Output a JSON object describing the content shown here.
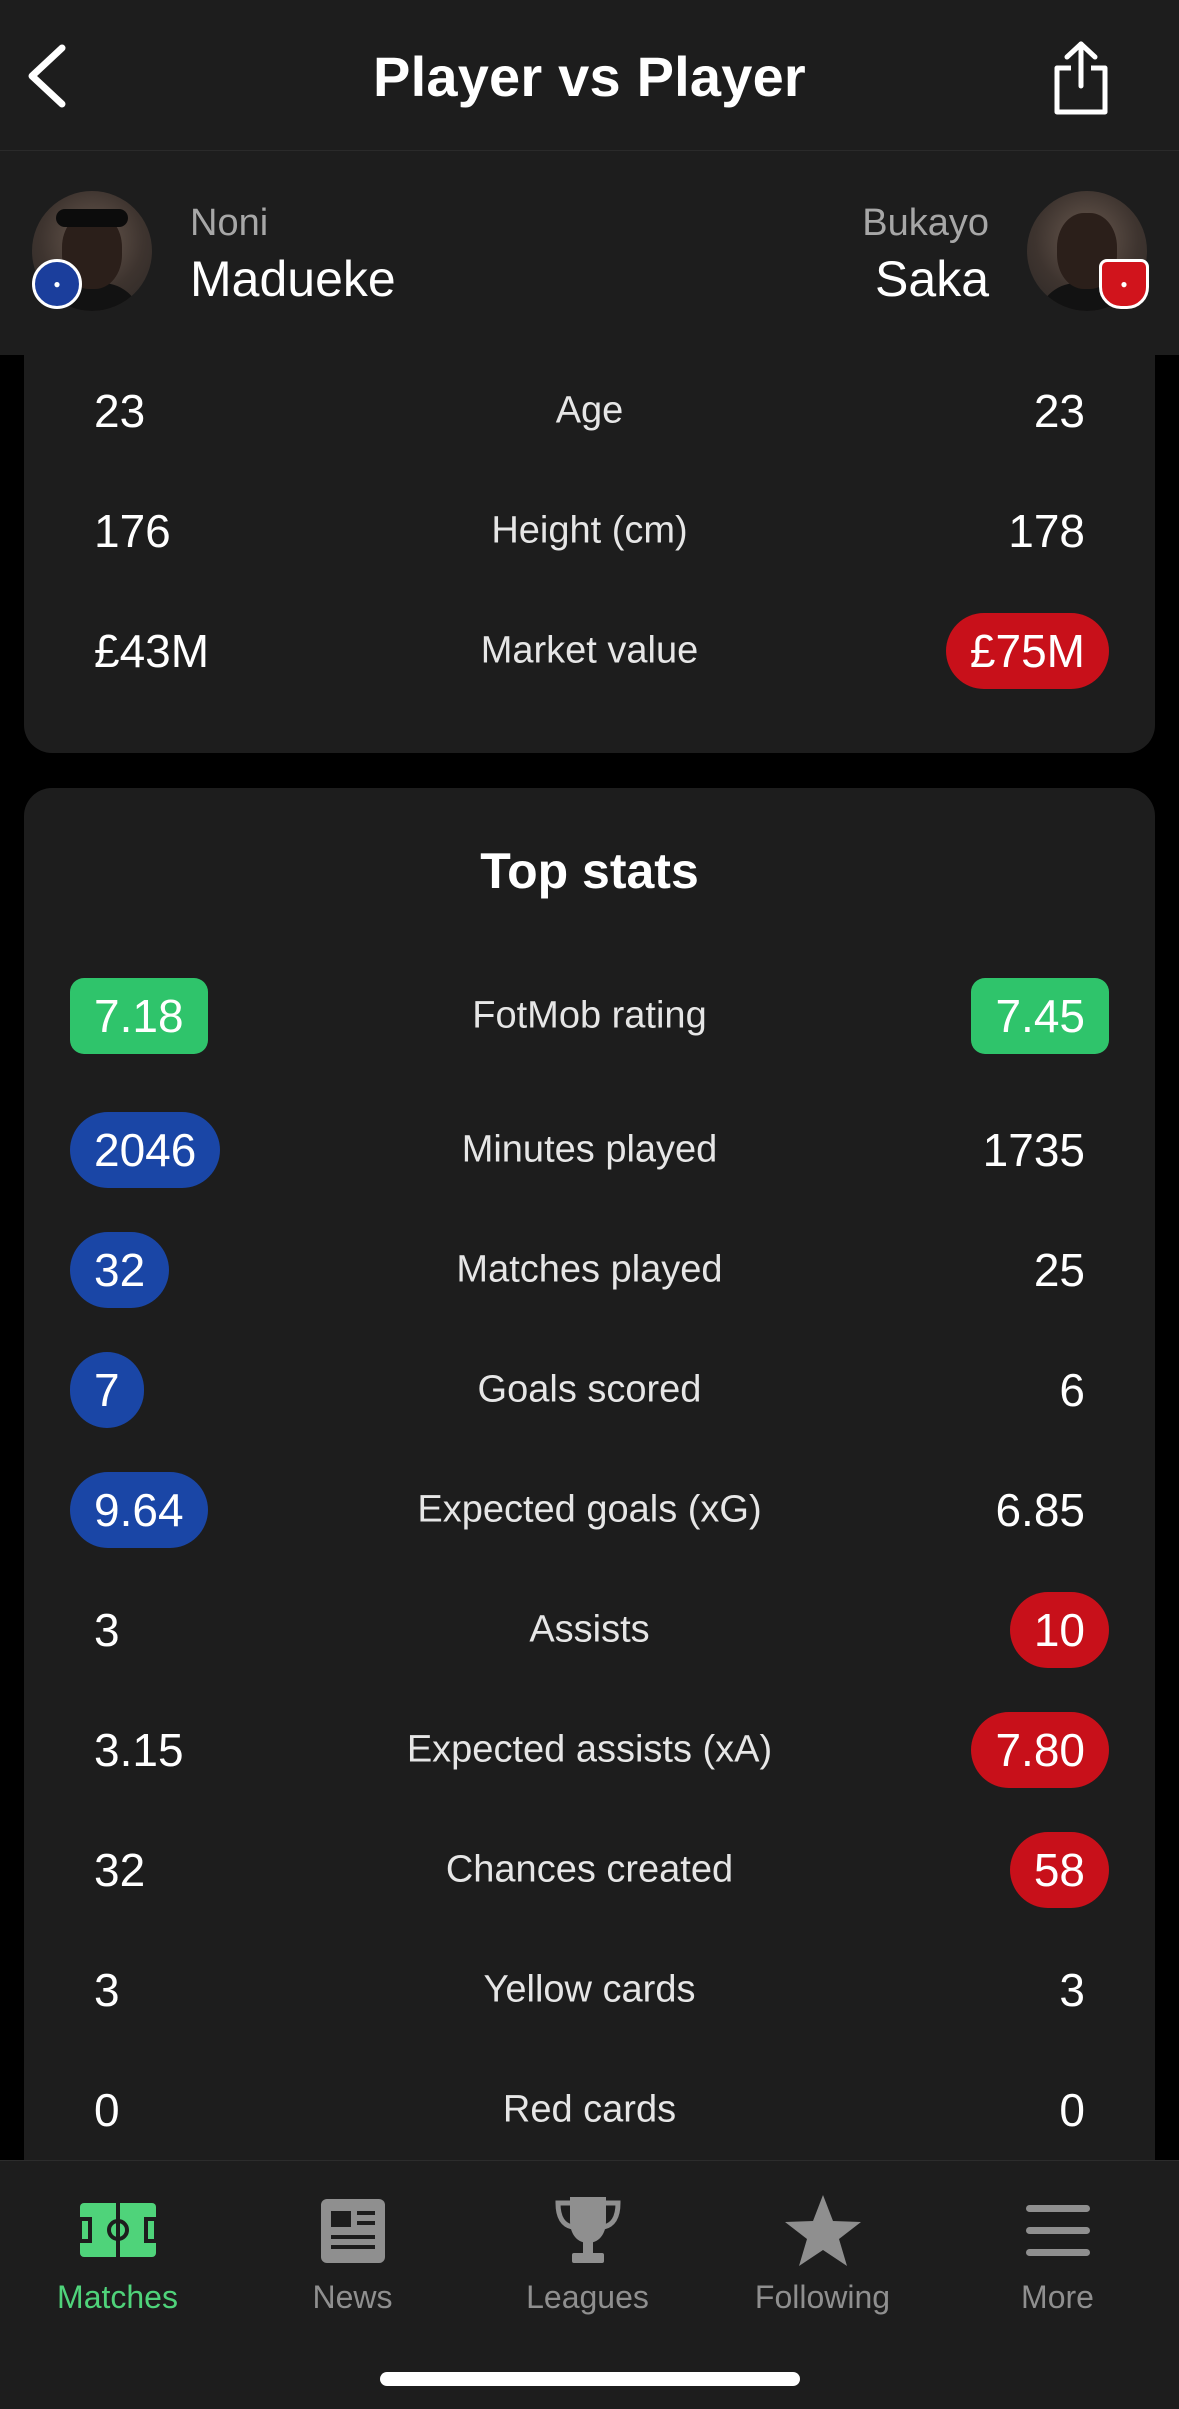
{
  "header": {
    "title": "Player vs Player"
  },
  "players": {
    "left": {
      "first_name": "Noni",
      "last_name": "Madueke",
      "club": "Chelsea"
    },
    "right": {
      "first_name": "Bukayo",
      "last_name": "Saka",
      "club": "Arsenal"
    }
  },
  "bio": [
    {
      "label": "Age",
      "left": "23",
      "right": "23",
      "highlight": "none"
    },
    {
      "label": "Height (cm)",
      "left": "176",
      "right": "178",
      "highlight": "none"
    },
    {
      "label": "Market value",
      "left": "£43M",
      "right": "£75M",
      "highlight": "right-red"
    }
  ],
  "top_stats": {
    "title": "Top stats",
    "rows": [
      {
        "label": "FotMob rating",
        "left": "7.18",
        "right": "7.45",
        "highlight": "both-green"
      },
      {
        "label": "Minutes played",
        "left": "2046",
        "right": "1735",
        "highlight": "left-blue"
      },
      {
        "label": "Matches played",
        "left": "32",
        "right": "25",
        "highlight": "left-blue"
      },
      {
        "label": "Goals scored",
        "left": "7",
        "right": "6",
        "highlight": "left-blue"
      },
      {
        "label": "Expected goals (xG)",
        "left": "9.64",
        "right": "6.85",
        "highlight": "left-blue"
      },
      {
        "label": "Assists",
        "left": "3",
        "right": "10",
        "highlight": "right-red"
      },
      {
        "label": "Expected assists (xA)",
        "left": "3.15",
        "right": "7.80",
        "highlight": "right-red"
      },
      {
        "label": "Chances created",
        "left": "32",
        "right": "58",
        "highlight": "right-red"
      },
      {
        "label": "Yellow cards",
        "left": "3",
        "right": "3",
        "highlight": "none"
      },
      {
        "label": "Red cards",
        "left": "0",
        "right": "0",
        "highlight": "none"
      }
    ]
  },
  "tabbar": {
    "items": [
      {
        "label": "Matches",
        "icon": "pitch-icon",
        "active": true
      },
      {
        "label": "News",
        "icon": "newspaper-icon",
        "active": false
      },
      {
        "label": "Leagues",
        "icon": "trophy-icon",
        "active": false
      },
      {
        "label": "Following",
        "icon": "star-icon",
        "active": false
      },
      {
        "label": "More",
        "icon": "menu-icon",
        "active": false
      }
    ]
  },
  "colors": {
    "background": "#000000",
    "card": "#1d1d1d",
    "blue_highlight": "#1a46a6",
    "red_highlight": "#c8101a",
    "green_rating": "#2fc46b",
    "active_tab": "#4fd37a",
    "inactive_tab": "#8f8f8f"
  }
}
